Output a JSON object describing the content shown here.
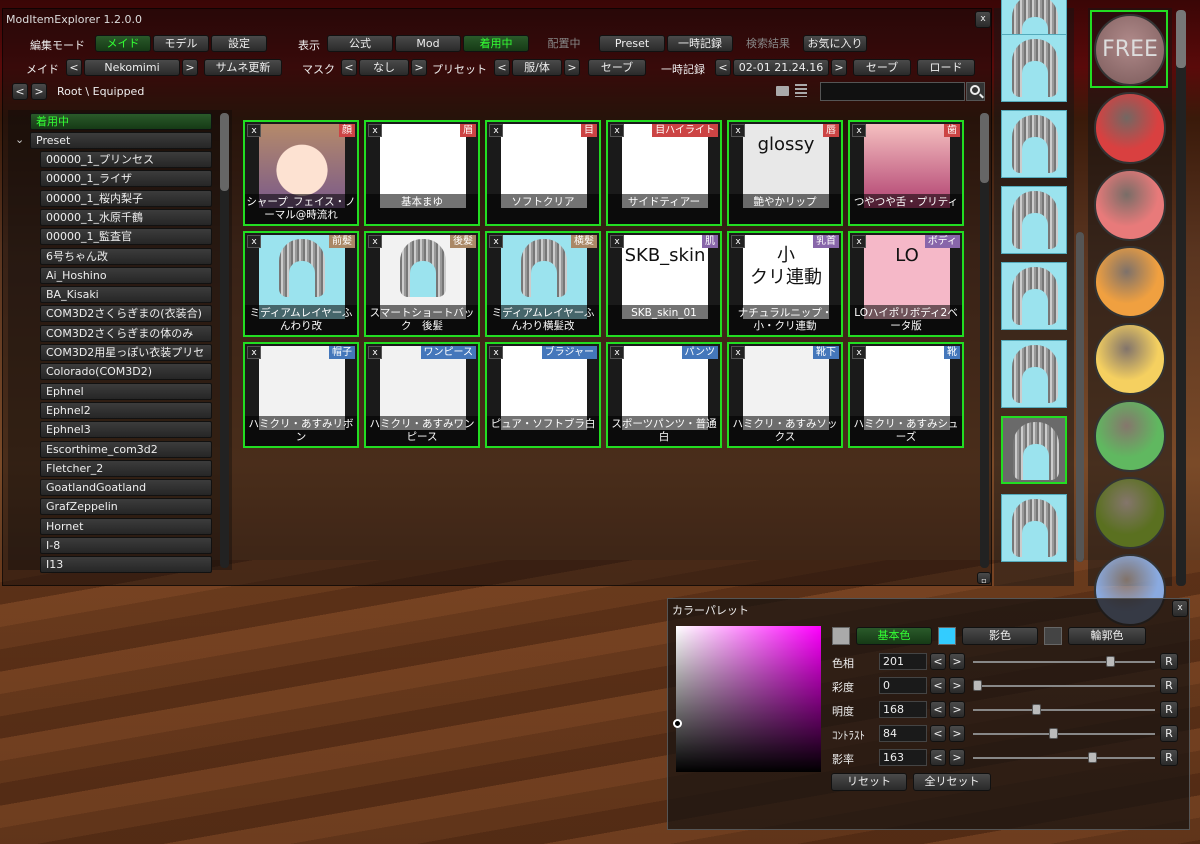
{
  "window_title": "ModItemExplorer 1.2.0.0",
  "row1": {
    "edit_mode_label": "編集モード",
    "mode_maid": "メイド",
    "mode_model": "モデル",
    "mode_settings": "設定",
    "display_label": "表示",
    "tab_official": "公式",
    "tab_mod": "Mod",
    "tab_equipped": "着用中",
    "tab_placed": "配置中",
    "tab_preset": "Preset",
    "tab_temp": "一時記録",
    "tab_search": "検索結果",
    "tab_fav": "お気に入り"
  },
  "row2": {
    "maid_label": "メイド",
    "maid_prev": "<",
    "maid_name": "Nekomimi",
    "maid_next": ">",
    "thumb_update": "サムネ更新",
    "mask_label": "マスク",
    "mask_prev": "<",
    "mask_value": "なし",
    "mask_next": ">",
    "preset_label": "プリセット",
    "preset_prev": "<",
    "preset_value": "服/体",
    "preset_next": ">",
    "preset_save": "セーブ",
    "temp_label": "一時記録",
    "temp_prev": "<",
    "temp_value": "02-01 21.24.16",
    "temp_next": ">",
    "temp_save": "セーブ",
    "temp_load": "ロード"
  },
  "breadcrumb": {
    "back": "<",
    "forward": ">",
    "path": "Root \\ Equipped"
  },
  "tree": {
    "equipped": "着用中",
    "preset": "Preset",
    "items": [
      "00000_1_プリンセス",
      "00000_1_ライザ",
      "00000_1_桜内梨子",
      "00000_1_水原千鶴",
      "00000_1_監査官",
      "6号ちゃん改",
      "Ai_Hoshino",
      "BA_Kisaki",
      "COM3D2さくらぎまの(衣装合)",
      "COM3D2さくらぎまの体のみ",
      "COM3D2用星っぽい衣装プリセ",
      "Colorado(COM3D2)",
      "Ephnel",
      "Ephnel2",
      "Ephnel3",
      "Escorthime_com3d2",
      "Fletcher_2",
      "GoatlandGoatland",
      "GrafZeppelin",
      "Hornet",
      "I-8",
      "I13"
    ]
  },
  "cards": [
    {
      "tag": "顔",
      "tag_color": "#c44",
      "name": "シャープ_フェイス・ノーマル@時流れ"
    },
    {
      "tag": "眉",
      "tag_color": "#c44",
      "name": "基本まゆ"
    },
    {
      "tag": "目",
      "tag_color": "#c44",
      "name": "ソフトクリア"
    },
    {
      "tag": "目ハイライト",
      "tag_color": "#c44",
      "name": "サイドティアー"
    },
    {
      "tag": "唇",
      "tag_color": "#c44",
      "name": "艶やかリップ",
      "thumb_text": "glossy"
    },
    {
      "tag": "歯",
      "tag_color": "#c44",
      "name": "つやつや舌・プリティ"
    },
    {
      "tag": "前髪",
      "tag_color": "#a86",
      "name": "ミディアムレイヤーふんわり改"
    },
    {
      "tag": "後髪",
      "tag_color": "#a86",
      "name": "スマートショートバック　後髪"
    },
    {
      "tag": "横髪",
      "tag_color": "#a86",
      "name": "ミディアムレイヤーふんわり横髪改"
    },
    {
      "tag": "肌",
      "tag_color": "#86a",
      "name": "SKB_skin_01",
      "thumb_text": "SKB_skin"
    },
    {
      "tag": "乳首",
      "tag_color": "#86a",
      "name": "ナチュラルニップ・小・クリ連動",
      "thumb_text": "小\nクリ連動"
    },
    {
      "tag": "ボディ",
      "tag_color": "#86a",
      "name": "LOハイポリボディ2ベータ版",
      "thumb_text": "LO"
    },
    {
      "tag": "帽子",
      "tag_color": "#47b",
      "name": "ハミクリ・あすみリボン"
    },
    {
      "tag": "ワンピース",
      "tag_color": "#47b",
      "name": "ハミクリ・あすみワンピース"
    },
    {
      "tag": "ブラジャー",
      "tag_color": "#47b",
      "name": "ピュア・ソフトブラ白"
    },
    {
      "tag": "パンツ",
      "tag_color": "#47b",
      "name": "スポーツパンツ・普通白"
    },
    {
      "tag": "靴下",
      "tag_color": "#47b",
      "name": "ハミクリ・あすみソックス"
    },
    {
      "tag": "靴",
      "tag_color": "#47b",
      "name": "ハミクリ・あすみシューズ"
    }
  ],
  "card_close": "x",
  "free_label": "FREE",
  "swatches": [
    "#d94040",
    "#e87a7a",
    "#f0a040",
    "#f5d060",
    "#60b860",
    "#5a7020",
    "#8aaae0"
  ],
  "palette": {
    "title": "カラーパレット",
    "close": "x",
    "base": "基本色",
    "shadow": "影色",
    "outline": "輪郭色",
    "base_color": "#aaaaaa",
    "shadow_color": "#33ccff",
    "outline_color": "#444444",
    "rows": [
      {
        "label": "色相",
        "value": "201",
        "level": 0.74
      },
      {
        "label": "彩度",
        "value": "0",
        "level": 0.0
      },
      {
        "label": "明度",
        "value": "168",
        "level": 0.33
      },
      {
        "label": "ｺﾝﾄﾗｽﾄ",
        "value": "84",
        "level": 0.42
      },
      {
        "label": "影率",
        "value": "163",
        "level": 0.64
      }
    ],
    "dec": "<",
    "inc": ">",
    "reset_r": "R",
    "reset": "リセット",
    "reset_all": "全リセット"
  },
  "close_x": "x"
}
